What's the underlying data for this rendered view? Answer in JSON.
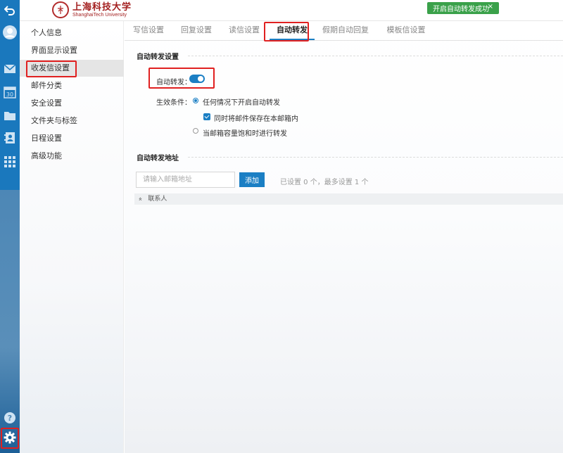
{
  "header": {
    "logo_cn": "上海科技大学",
    "logo_en": "ShanghaiTech University",
    "toast_text": "开启自动转发成功",
    "toast_close": "×"
  },
  "rail": {
    "icons": [
      "back-icon",
      "avatar-icon",
      "mail-icon",
      "calendar-icon",
      "folder-icon",
      "contacts-icon",
      "apps-icon",
      "help-icon",
      "gear-icon"
    ],
    "calendar_day": "30",
    "help_glyph": "?"
  },
  "sidebar": {
    "items": [
      {
        "label": "个人信息"
      },
      {
        "label": "界面显示设置"
      },
      {
        "label": "收发信设置"
      },
      {
        "label": "邮件分类"
      },
      {
        "label": "安全设置"
      },
      {
        "label": "文件夹与标签"
      },
      {
        "label": "日程设置"
      },
      {
        "label": "高级功能"
      }
    ],
    "active_index": 2
  },
  "tabs": [
    {
      "label": "写信设置"
    },
    {
      "label": "回复设置"
    },
    {
      "label": "读信设置"
    },
    {
      "label": "自动转发"
    },
    {
      "label": "假期自动回复"
    },
    {
      "label": "模板信设置"
    }
  ],
  "active_tab": 3,
  "auto_forward": {
    "section_title": "自动转发设置",
    "toggle_label": "自动转发：",
    "toggle_on": true,
    "condition_label": "生效条件：",
    "option_always": "任何情况下开启自动转发",
    "option_always_selected": true,
    "keep_copy": "同时将邮件保存在本邮箱内",
    "keep_copy_checked": true,
    "option_full": "当邮箱容量饱和时进行转发"
  },
  "forward_address": {
    "section_title": "自动转发地址",
    "placeholder": "请输入邮箱地址",
    "value": "",
    "add_button": "添加",
    "limit_text": "已设置 0 个，最多设置 1 个",
    "contacts_label": "联系人",
    "contacts_toggle": "»"
  },
  "colors": {
    "accent": "#1b7fc4",
    "highlight_box": "#e02020",
    "toast": "#3aa14a"
  }
}
